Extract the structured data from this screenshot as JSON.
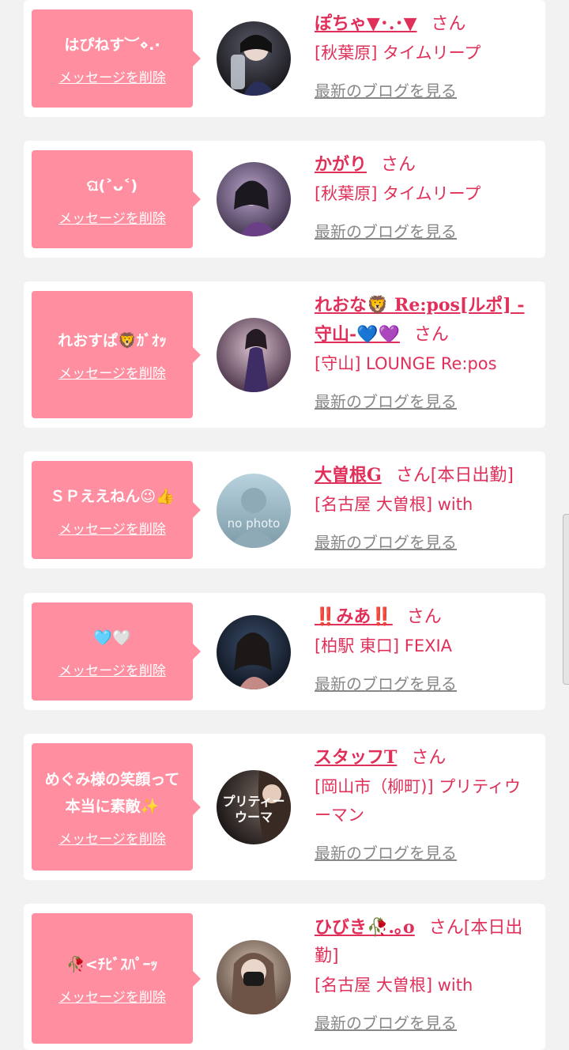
{
  "cards": [
    {
      "message": "はぴねす︶⋄.·",
      "delete_label": "メッセージを削除",
      "name": "ぽちゃ▼･.･▼",
      "honorific": "さん",
      "shop": "[秋葉原] タイムリープ",
      "blog_label": "最新のブログを見る",
      "avatar_colors": [
        "#5a5a6a",
        "#1a1a1e"
      ]
    },
    {
      "message": "ଘ(˃ᴗ˂)",
      "delete_label": "メッセージを削除",
      "name": "かがり",
      "honorific": "さん",
      "shop": "[秋葉原] タイムリープ",
      "blog_label": "最新のブログを見る",
      "avatar_colors": [
        "#b7a2c8",
        "#3c2f4a"
      ]
    },
    {
      "message": "れおすぱ🦁ｶﾞｵｯ",
      "delete_label": "メッセージを削除",
      "name": "れおな🦁 Re:pos[ルポ] -守山-💙💜",
      "honorific": "さん",
      "shop": "[守山] LOUNGE Re:pos",
      "blog_label": "最新のブログを見る",
      "avatar_colors": [
        "#d9c0cc",
        "#4a3248"
      ]
    },
    {
      "message": "ＳＰええねん😉👍",
      "delete_label": "メッセージを削除",
      "name": "大曽根G",
      "honorific": "さん[本日出勤]",
      "shop": "[名古屋 大曽根] with",
      "blog_label": "最新のブログを見る",
      "avatar_colors": [
        "#b8d3de",
        "#7d9aa8"
      ],
      "avatar_text": "no photo"
    },
    {
      "message": "🩵🤍",
      "delete_label": "メッセージを削除",
      "name": "‼️みあ‼️",
      "honorific": "さん",
      "shop": "[柏駅 東口] FEXIA",
      "blog_label": "最新のブログを見る",
      "avatar_colors": [
        "#3a4d6a",
        "#0f1520"
      ]
    },
    {
      "message": "めぐみ様の笑顔って本当に素敵✨",
      "delete_label": "メッセージを削除",
      "name": "スタッフT",
      "honorific": "さん",
      "shop": "[岡山市（柳町)] プリティウーマン",
      "blog_label": "最新のブログを見る",
      "avatar_colors": [
        "#7a6a62",
        "#1a1616"
      ],
      "avatar_text": "プリティーウーマ"
    },
    {
      "message": "🥀<ﾁﾋﾞｽﾊﾟｰｯ",
      "delete_label": "メッセージを削除",
      "name": "ひびき🥀.｡o",
      "honorific": "さん[本日出勤]",
      "shop": "[名古屋 大曽根] with",
      "blog_label": "最新のブログを見る",
      "avatar_colors": [
        "#d6c6b8",
        "#5e4a3e"
      ]
    }
  ],
  "colors": {
    "accent": "#e0305a",
    "bubble": "#ff8fa0",
    "background": "#f2f2f2",
    "blog_link": "#888888"
  }
}
